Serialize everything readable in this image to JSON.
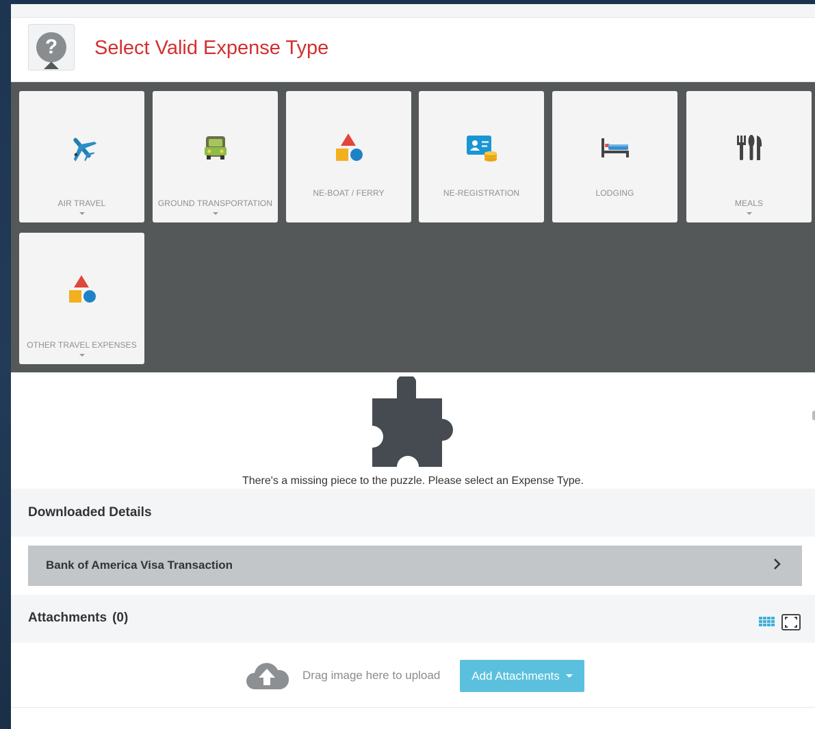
{
  "header": {
    "help_icon_glyph": "?",
    "title": "Select Valid Expense Type",
    "title_color": "#d32f2f"
  },
  "expense_types": [
    {
      "label": "AIR TRAVEL",
      "icon": "airplane-icon",
      "has_dropdown": true
    },
    {
      "label": "GROUND TRANSPORTATION",
      "icon": "car-icon",
      "has_dropdown": true
    },
    {
      "label": "NE-BOAT / FERRY",
      "icon": "shapes-icon",
      "has_dropdown": false
    },
    {
      "label": "NE-REGISTRATION",
      "icon": "id-card-coins-icon",
      "has_dropdown": false
    },
    {
      "label": "LODGING",
      "icon": "bed-icon",
      "has_dropdown": false
    },
    {
      "label": "MEALS",
      "icon": "utensils-icon",
      "has_dropdown": true
    },
    {
      "label": "OTHER TRAVEL EXPENSES",
      "icon": "shapes-icon",
      "has_dropdown": true
    }
  ],
  "puzzle": {
    "icon": "puzzle-piece-icon",
    "message": "There's a missing piece to the puzzle. Please select an Expense Type."
  },
  "downloaded_details": {
    "title": "Downloaded Details",
    "transaction_label": "Bank of America Visa Transaction"
  },
  "attachments": {
    "title": "Attachments",
    "count": "(0)",
    "drag_text": "Drag image here to upload",
    "add_button_label": "Add Attachments",
    "accent_color": "#5bc0de"
  }
}
